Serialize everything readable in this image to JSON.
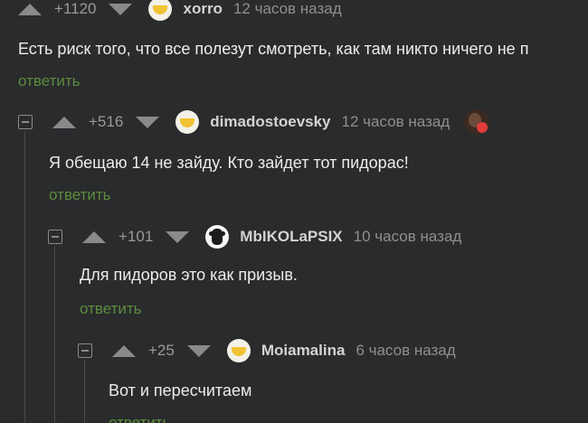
{
  "comments": [
    {
      "rating": "+1120",
      "username": "xorro",
      "time": "12 часов назад",
      "text": "Есть риск того, что все полезут смотреть, как там никто ничего не п",
      "reply_label": "ответить",
      "avatar_icon": "smiley-avatar-icon"
    },
    {
      "rating": "+516",
      "username": "dimadostoevsky",
      "time": "12 часов назад",
      "text": "Я обещаю 14 не зайду. Кто зайдет тот пидорас!",
      "reply_label": "ответить",
      "avatar_icon": "smiley-avatar-icon",
      "badge_icon": "author-heart-badge-icon"
    },
    {
      "rating": "+101",
      "username": "MbIKOLaPSIX",
      "time": "10 часов назад",
      "text": "Для пидоров это как призыв.",
      "reply_label": "ответить",
      "avatar_icon": "bear-avatar-icon"
    },
    {
      "rating": "+25",
      "username": "Moiamalina",
      "time": "6 часов назад",
      "text": "Вот и пересчитаем",
      "reply_label": "ответить",
      "avatar_icon": "smiley-avatar-icon"
    }
  ],
  "colors": {
    "background": "#2a2b2d",
    "reply_link": "#5c8c3c",
    "text": "#ececec",
    "muted": "#8f8f8f"
  }
}
